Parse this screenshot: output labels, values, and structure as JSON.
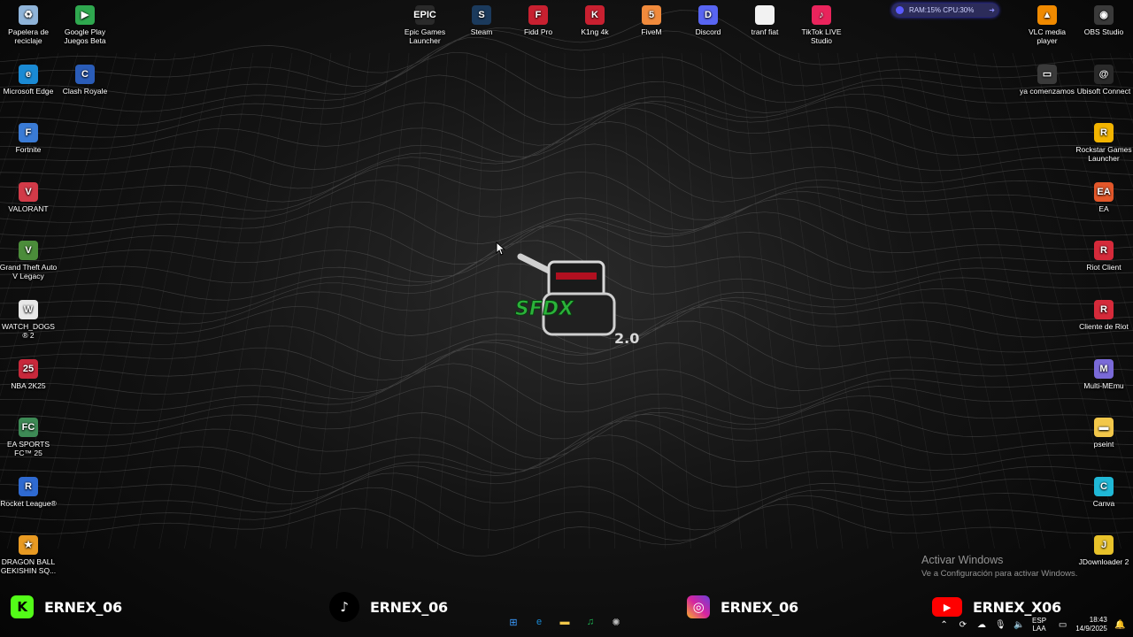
{
  "desktop": {
    "left_column": [
      {
        "label": "Papelera de reciclaje",
        "icon": "recycle-bin-icon",
        "color": "#8fb4d9",
        "glyph": "♻"
      },
      {
        "label": "Microsoft Edge",
        "icon": "edge-icon",
        "color": "#1a8ad4",
        "glyph": "e"
      },
      {
        "label": "Fortnite",
        "icon": "fortnite-icon",
        "color": "#3a7bd5",
        "glyph": "F"
      },
      {
        "label": "VALORANT",
        "icon": "valorant-icon",
        "color": "#d23a48",
        "glyph": "V"
      },
      {
        "label": "Grand Theft Auto V Legacy",
        "icon": "gta-icon",
        "color": "#4b8c3a",
        "glyph": "V"
      },
      {
        "label": "WATCH_DOGS® 2",
        "icon": "watchdogs-icon",
        "color": "#e8e8e8",
        "glyph": "W"
      },
      {
        "label": "NBA 2K25",
        "icon": "nba-icon",
        "color": "#c8283b",
        "glyph": "25"
      },
      {
        "label": "EA SPORTS FC™ 25",
        "icon": "eafc-icon",
        "color": "#3d8a55",
        "glyph": "FC"
      },
      {
        "label": "Rocket League®",
        "icon": "rocket-league-icon",
        "color": "#2f6ad1",
        "glyph": "R"
      },
      {
        "label": "DRAGON BALL GEKISHIN SQ...",
        "icon": "dragonball-icon",
        "color": "#e89a22",
        "glyph": "★"
      }
    ],
    "second_column": [
      {
        "label": "Google Play Juegos Beta",
        "icon": "google-play-games-icon",
        "color": "#2fa84f",
        "glyph": "▶"
      },
      {
        "label": "Clash Royale",
        "icon": "clash-royale-icon",
        "color": "#2a5cb8",
        "glyph": "C"
      }
    ],
    "top_row": [
      {
        "label": "Epic Games Launcher",
        "icon": "epic-games-icon",
        "color": "#2a2a2a",
        "glyph": "EPIC"
      },
      {
        "label": "Steam",
        "icon": "steam-icon",
        "color": "#1b3a5c",
        "glyph": "S"
      },
      {
        "label": "Fidd Pro",
        "icon": "fidd-pro-icon",
        "color": "#c82030",
        "glyph": "F"
      },
      {
        "label": "K1ng 4k",
        "icon": "king4k-icon",
        "color": "#c82030",
        "glyph": "K"
      },
      {
        "label": "FiveM",
        "icon": "fivem-icon",
        "color": "#f08a3c",
        "glyph": "5"
      },
      {
        "label": "Discord",
        "icon": "discord-icon",
        "color": "#5865f2",
        "glyph": "D"
      },
      {
        "label": "tranf fiat",
        "icon": "document-icon",
        "color": "#f2f2f2",
        "glyph": ""
      },
      {
        "label": "TikTok LIVE Studio",
        "icon": "tiktok-live-icon",
        "color": "#e9245c",
        "glyph": "♪"
      }
    ],
    "right_column": [
      {
        "label": "OBS Studio",
        "icon": "obs-icon",
        "color": "#3a3a3a",
        "glyph": "◉"
      },
      {
        "label": "Ubisoft Connect",
        "icon": "ubisoft-icon",
        "color": "#2a2a2a",
        "glyph": "@"
      },
      {
        "label": "Rockstar Games Launcher",
        "icon": "rockstar-icon",
        "color": "#f2b400",
        "glyph": "R"
      },
      {
        "label": "EA",
        "icon": "ea-icon",
        "color": "#e2572a",
        "glyph": "EA"
      },
      {
        "label": "Riot Client",
        "icon": "riot-client-icon",
        "color": "#d52a3a",
        "glyph": "R"
      },
      {
        "label": "Cliente de Riot",
        "icon": "riot-client-icon",
        "color": "#d52a3a",
        "glyph": "R"
      },
      {
        "label": "Multi-MEmu",
        "icon": "memu-icon",
        "color": "#7a6ad8",
        "glyph": "M"
      },
      {
        "label": "pseint",
        "icon": "folder-icon",
        "color": "#f2c74a",
        "glyph": "▬"
      },
      {
        "label": "Canva",
        "icon": "canva-icon",
        "color": "#20b8d6",
        "glyph": "C"
      },
      {
        "label": "JDownloader 2",
        "icon": "jdownloader-icon",
        "color": "#e8c22a",
        "glyph": "J"
      }
    ],
    "second_right_column": [
      {
        "label": "VLC media player",
        "icon": "vlc-icon",
        "color": "#f08a00",
        "glyph": "▲"
      },
      {
        "label": "ya comenzamos",
        "icon": "shortcut-icon",
        "color": "#3a3a3a",
        "glyph": "▭"
      }
    ]
  },
  "perf_widget": {
    "text": "RAM:15%  CPU:30%"
  },
  "watermark": {
    "title": "Activar Windows",
    "subtitle": "Ve a Configuración para activar Windows."
  },
  "socials": [
    {
      "platform": "kick",
      "handle": "ERNEX_06",
      "color": "#53fc18"
    },
    {
      "platform": "tiktok",
      "handle": "ERNEX_06",
      "color": "#000000"
    },
    {
      "platform": "instagram",
      "handle": "ERNEX_06",
      "color": "#d6249f"
    },
    {
      "platform": "youtube",
      "handle": "ERNEX_X06",
      "color": "#ff0000"
    }
  ],
  "center_logo": {
    "line1": "SFDX",
    "line2": "2.0"
  },
  "taskbar": {
    "apps": [
      {
        "name": "start-button",
        "color": "#3b9cff",
        "glyph": "⊞"
      },
      {
        "name": "edge-taskbar-icon",
        "color": "#1a8ad4",
        "glyph": "e"
      },
      {
        "name": "file-explorer-icon",
        "color": "#f2c74a",
        "glyph": "▬"
      },
      {
        "name": "spotify-icon",
        "color": "#1db954",
        "glyph": "♫"
      },
      {
        "name": "chatgpt-icon",
        "color": "#bbbbbb",
        "glyph": "✺"
      }
    ],
    "tray": {
      "lang1": "ESP",
      "lang2": "LAA",
      "time": "18:43",
      "date": "14/9/2025"
    }
  }
}
